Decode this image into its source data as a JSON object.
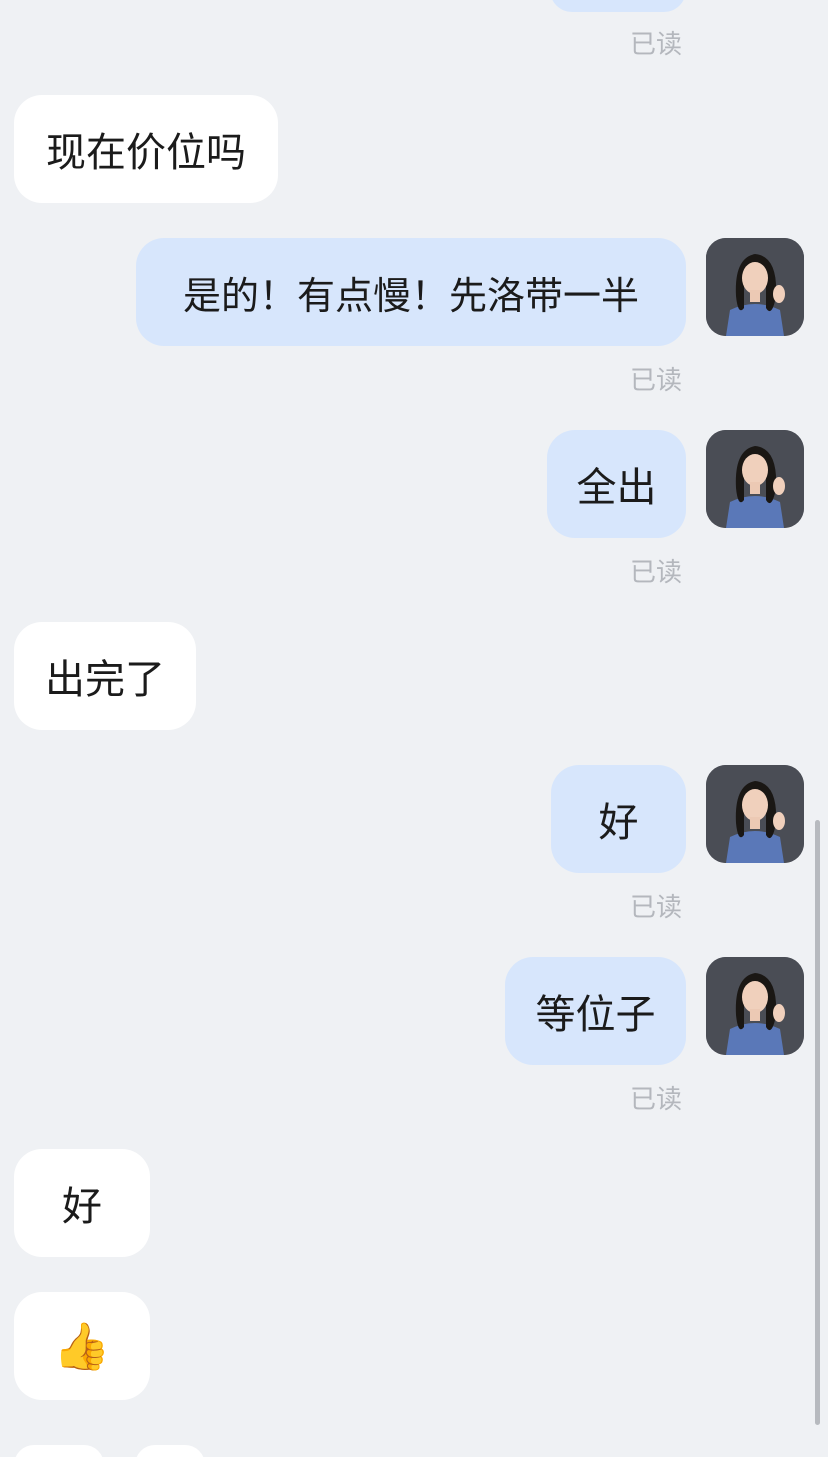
{
  "status": {
    "read_label": "已读"
  },
  "messages": [
    {
      "side": "in",
      "text": "现在价位吗"
    },
    {
      "side": "out",
      "text": "是的！有点慢！先洛带一半",
      "read": "已读"
    },
    {
      "side": "out",
      "text": "全出",
      "read": "已读"
    },
    {
      "side": "in",
      "text": "出完了"
    },
    {
      "side": "out",
      "text": "好",
      "read": "已读"
    },
    {
      "side": "out",
      "text": "等位子",
      "read": "已读"
    },
    {
      "side": "in",
      "text": "好"
    },
    {
      "side": "in",
      "emoji": "👍",
      "emoji_name": "thumbs-up-emoji"
    }
  ],
  "colors": {
    "background": "#eff1f4",
    "outgoing_bubble": "#d7e6fc",
    "incoming_bubble": "#ffffff",
    "read_text": "#b4b7bd"
  },
  "avatar_icon": "user-avatar-photo"
}
